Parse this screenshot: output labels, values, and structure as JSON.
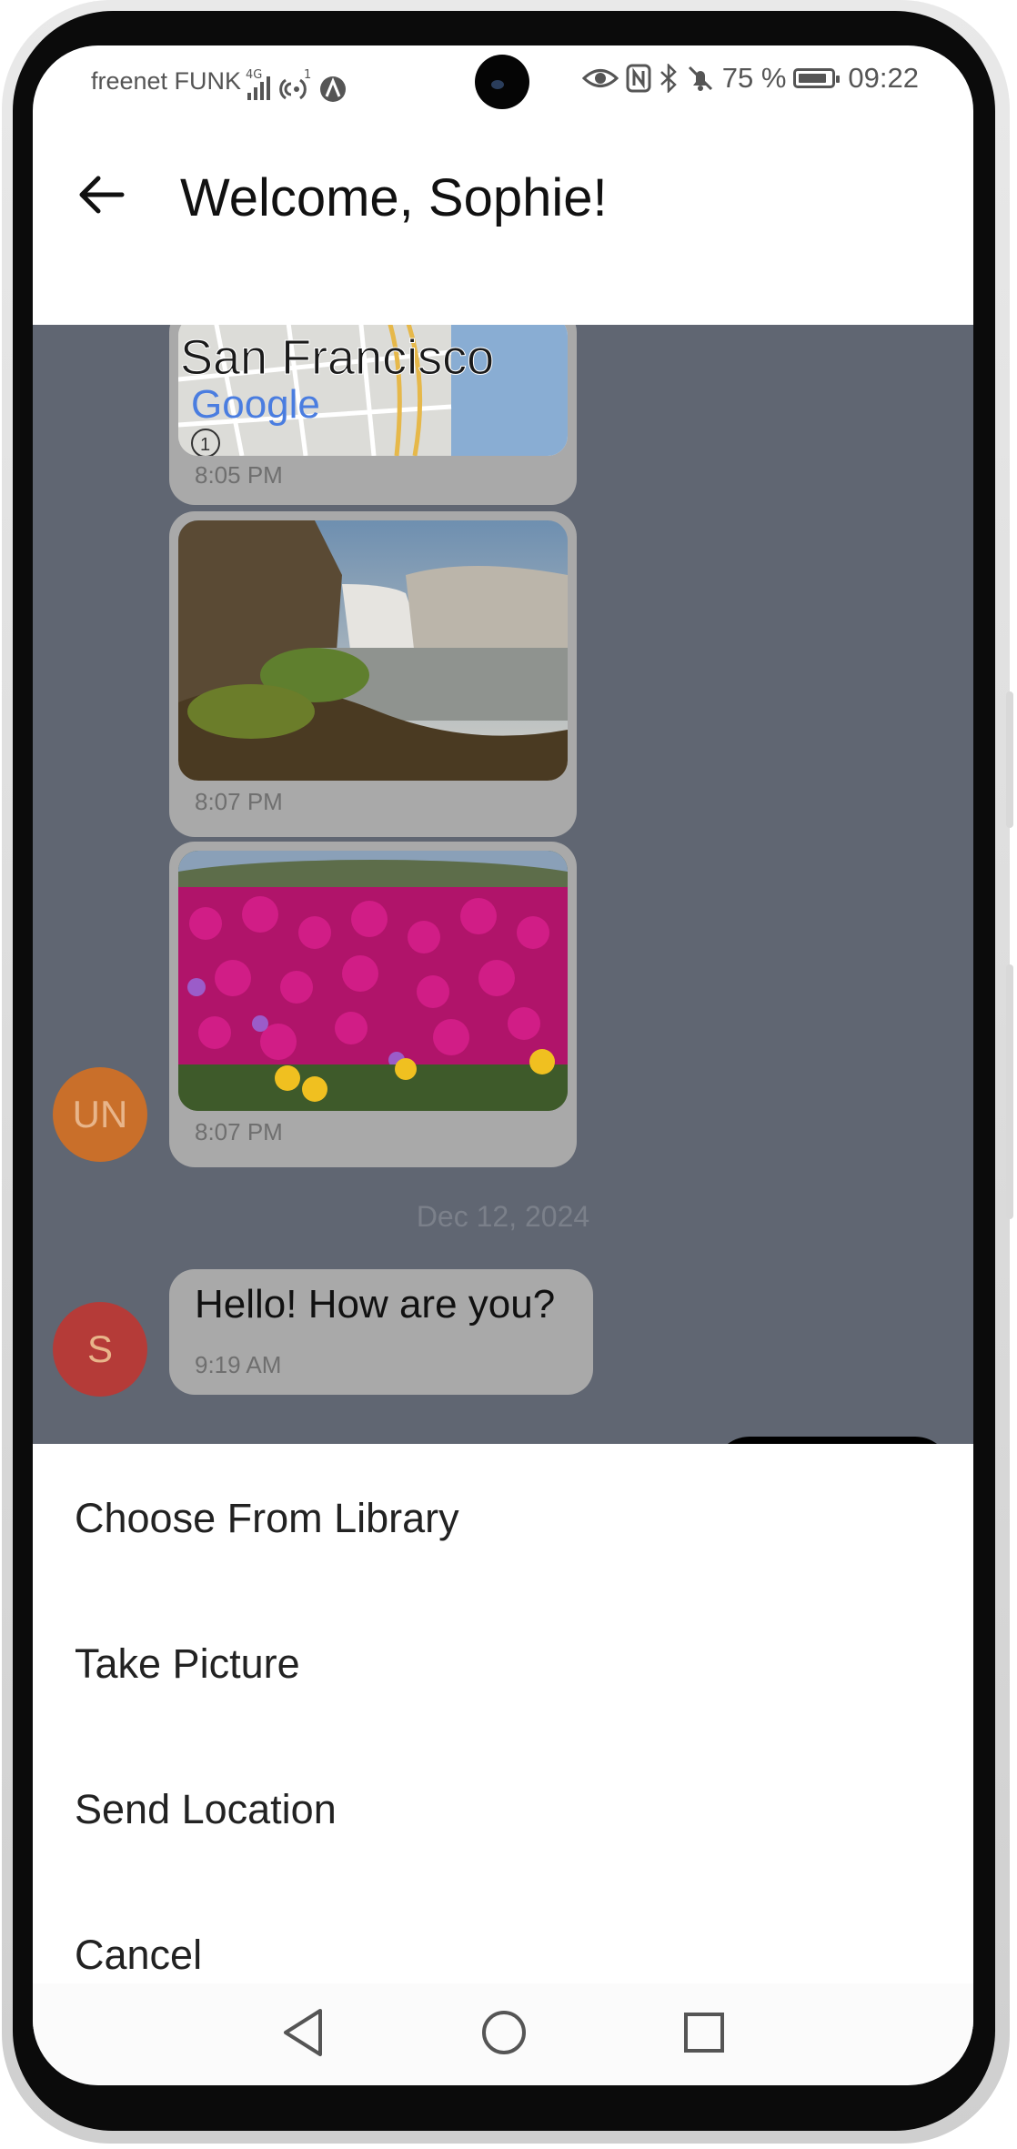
{
  "status_bar": {
    "carrier": "freenet FUNK",
    "network": "4G",
    "battery_percent": "75 %",
    "time": "09:22"
  },
  "header": {
    "title": "Welcome, Sophie!",
    "back_icon": "arrow-left-icon"
  },
  "chat": {
    "messages": [
      {
        "type": "map",
        "map_label": "San Francisco",
        "map_brand": "Google",
        "map_marker": "1",
        "time": "8:05 PM"
      },
      {
        "type": "image",
        "image_subject": "waterfall",
        "time": "8:07 PM"
      },
      {
        "type": "image",
        "image_subject": "flowers",
        "time": "8:07 PM"
      },
      {
        "type": "text",
        "text": "Hello! How are you?",
        "time": "9:19 AM"
      }
    ],
    "avatars": [
      {
        "initials": "UN",
        "color": "#c96f2a"
      },
      {
        "initials": "S",
        "color": "#b53b38"
      }
    ],
    "date_separator": "Dec 12, 2024"
  },
  "action_sheet": {
    "options": [
      "Choose From Library",
      "Take Picture",
      "Send Location",
      "Cancel"
    ]
  },
  "navigation": {
    "back": "triangle-back-icon",
    "home": "circle-home-icon",
    "recents": "square-recents-icon"
  },
  "colors": {
    "overlay_bg": "#606672",
    "bubble_bg": "#a9a9a9",
    "sheet_bg": "#ffffff"
  }
}
